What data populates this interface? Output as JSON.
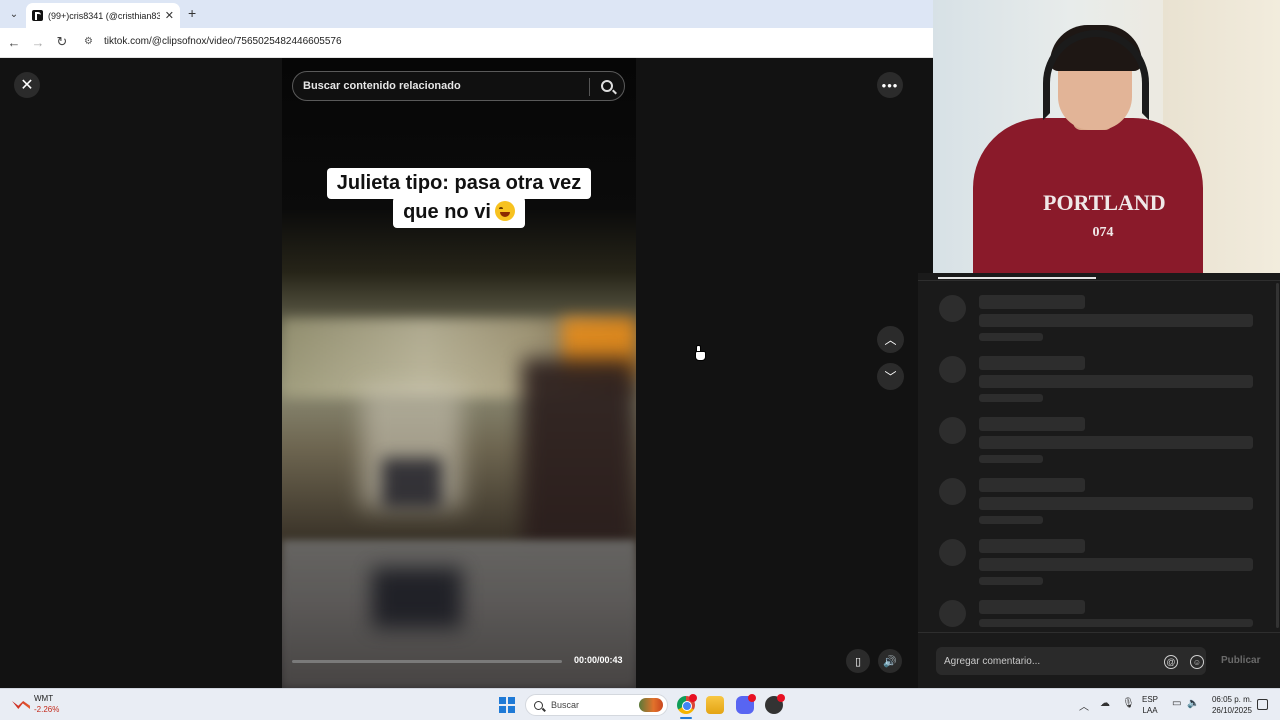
{
  "browser": {
    "tab_title": "(99+)cris8341 (@cristhian8341)",
    "tab_close": "✕",
    "new_tab": "+",
    "url": "tiktok.com/@clipsofnox/video/7565025482446605576"
  },
  "viewer": {
    "search_placeholder": "Buscar contenido relacionado",
    "caption_line1": "Julieta tipo: pasa otra vez",
    "caption_line2": "que no vi",
    "time": "00:00/00:43",
    "progress": 0
  },
  "webcam": {
    "shirt_text": "PORTLAND",
    "shirt_number": "074"
  },
  "comments": {
    "placeholder": "Agregar comentario...",
    "post_label": "Publicar"
  },
  "taskbar": {
    "stock_name": "WMT",
    "stock_change": "-2.26%",
    "search_label": "Buscar",
    "lang_top": "ESP",
    "lang_bottom": "LAA",
    "time": "06:05 p. m.",
    "date": "26/10/2025"
  }
}
